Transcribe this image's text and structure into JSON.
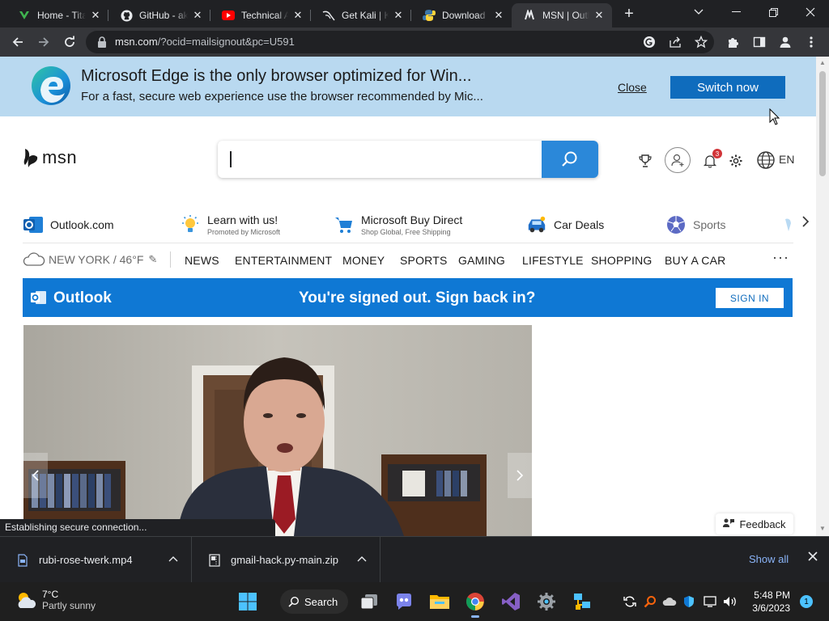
{
  "tabs": [
    {
      "title": "Home - Tita",
      "favicon": "titan-icon"
    },
    {
      "title": "GitHub - ak",
      "favicon": "github-icon"
    },
    {
      "title": "Technical A",
      "favicon": "youtube-icon"
    },
    {
      "title": "Get Kali | K",
      "favicon": "kali-icon"
    },
    {
      "title": "Download",
      "favicon": "python-icon"
    },
    {
      "title": "MSN | Outl",
      "favicon": "msn-icon"
    }
  ],
  "toolbar": {
    "url_host": "msn.com",
    "url_path": "/?ocid=mailsignout&pc=U591"
  },
  "edge_banner": {
    "headline": "Microsoft Edge is the only browser optimized for Win...",
    "subline": "For a fast, secure web experience use the browser recommended by Mic...",
    "close_label": "Close",
    "switch_label": "Switch now"
  },
  "header": {
    "logo_text": "msn",
    "notification_count": "3",
    "language": "EN"
  },
  "quick_links": [
    {
      "title": "Outlook.com",
      "subtitle": ""
    },
    {
      "title": "Learn with us!",
      "subtitle": "Promoted by Microsoft"
    },
    {
      "title": "Microsoft Buy Direct",
      "subtitle": "Shop Global, Free Shipping"
    },
    {
      "title": "Car Deals",
      "subtitle": ""
    },
    {
      "title": "Sports",
      "subtitle": ""
    }
  ],
  "navbar": {
    "weather": "NEW YORK / 46°F",
    "items": [
      "NEWS",
      "ENTERTAINMENT",
      "MONEY",
      "SPORTS",
      "GAMING",
      "LIFESTYLE",
      "SHOPPING",
      "BUY A CAR"
    ],
    "more": "···"
  },
  "outlook_bar": {
    "brand": "Outlook",
    "message": "You're signed out. Sign back in?",
    "signin_label": "SIGN IN"
  },
  "feedback_label": "Feedback",
  "status_text": "Establishing secure connection...",
  "downloads": {
    "items": [
      {
        "name": "rubi-rose-twerk.mp4"
      },
      {
        "name": "gmail-hack.py-main.zip"
      }
    ],
    "show_all": "Show all"
  },
  "taskbar": {
    "temperature": "7°C",
    "condition": "Partly sunny",
    "search_label": "Search",
    "time": "5:48 PM",
    "date": "3/6/2023",
    "notification_badge": "1"
  },
  "colors": {
    "outlook_blue": "#0f78d4",
    "edge_banner_bg": "#b9d9f0",
    "search_button": "#2b88d9",
    "chrome_dark": "#202124"
  }
}
